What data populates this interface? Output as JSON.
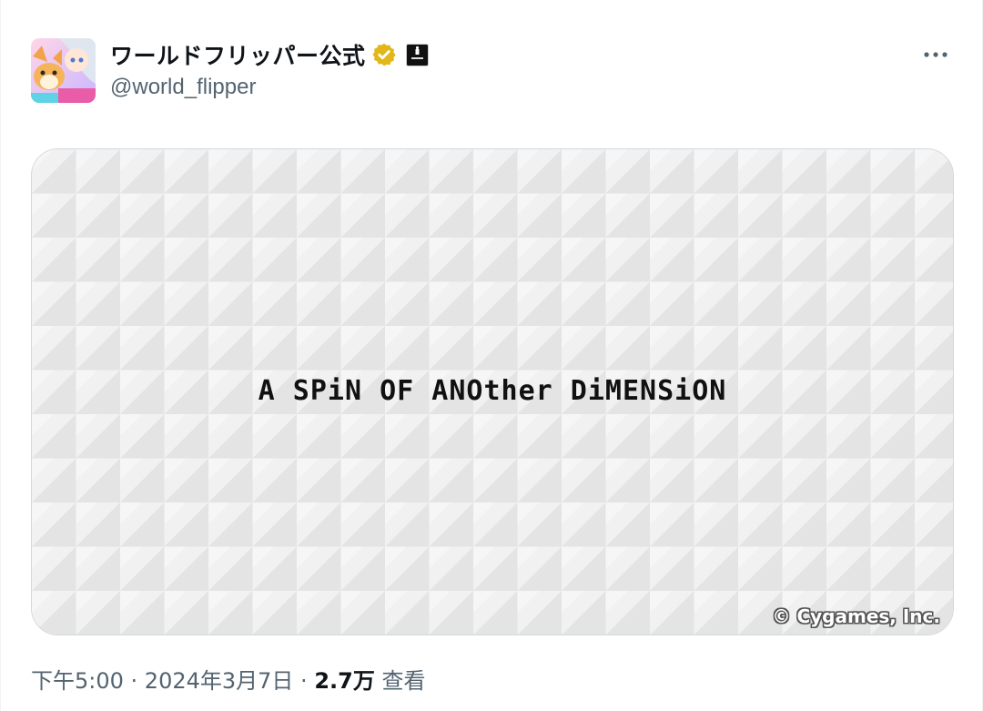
{
  "author": {
    "display_name": "ワールドフリッパー公式",
    "handle": "@world_flipper",
    "verified_badge_icon": "verified-gold-check-icon",
    "affiliate_icon": "cygames-affiliate-icon"
  },
  "menu": {
    "more_icon": "more-horizontal-icon"
  },
  "media": {
    "tagline": "A SPiN OF ANOther DiMENSiON",
    "copyright": "© Cygames, Inc."
  },
  "meta": {
    "time": "下午5:00",
    "separator1": " · ",
    "date": "2024年3月7日",
    "separator2": " · ",
    "views_count": "2.7万",
    "views_label": "查看"
  },
  "colors": {
    "text_primary": "#0f1419",
    "text_secondary": "#536471",
    "border": "#cfd9de",
    "badge_gold": "#e2b719"
  }
}
